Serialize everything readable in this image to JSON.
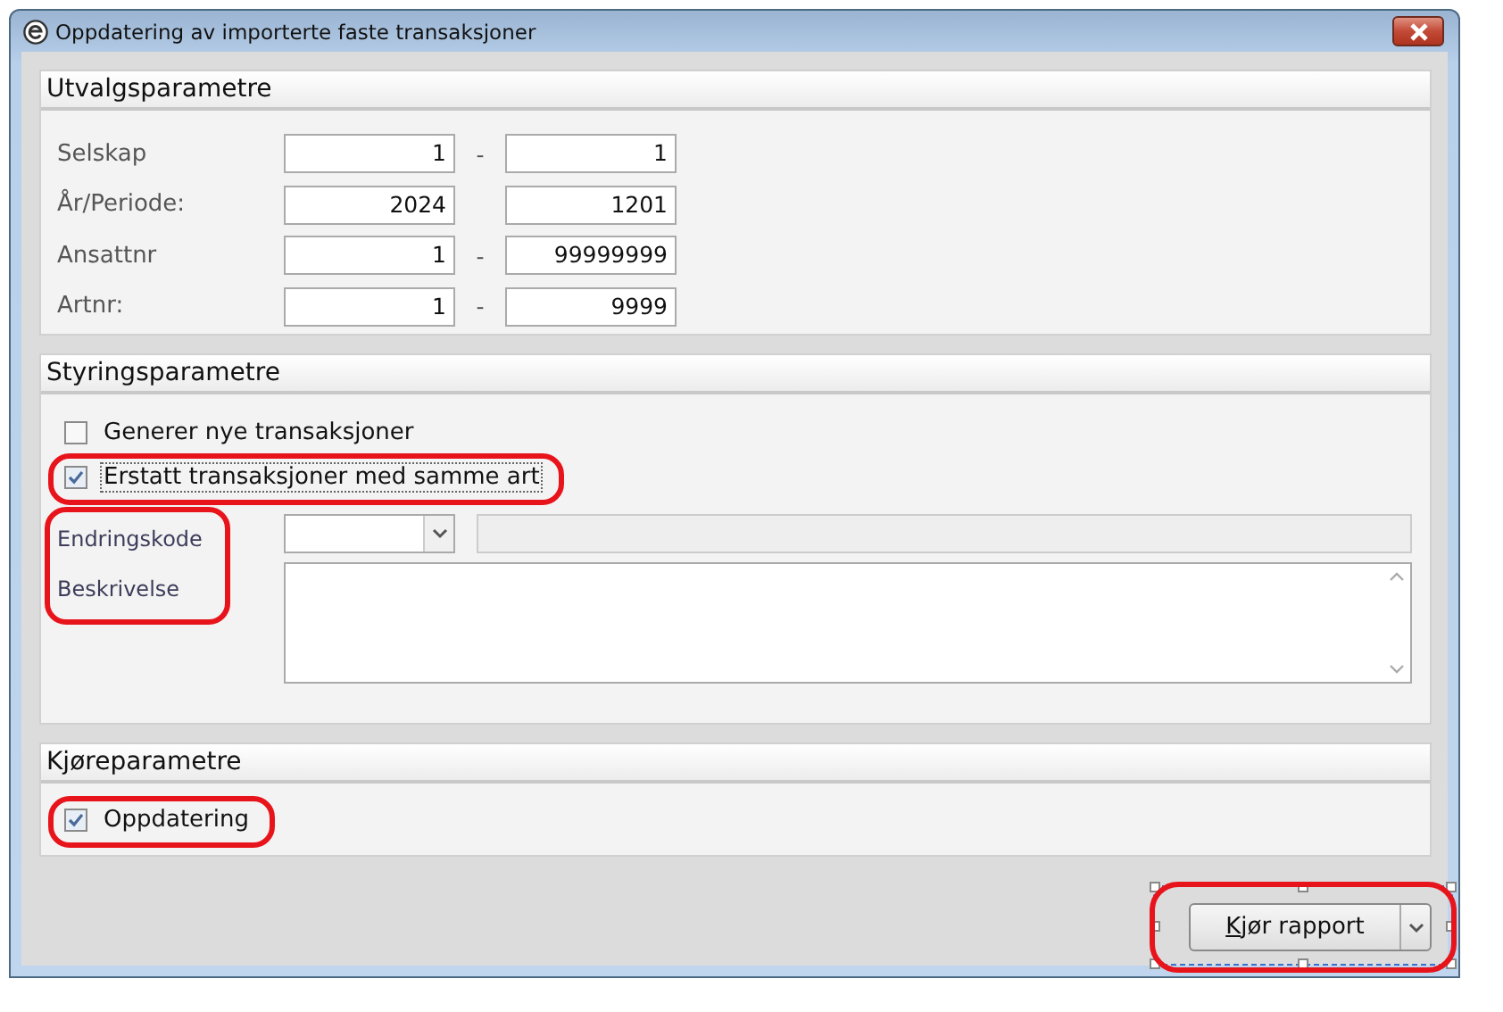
{
  "window": {
    "title": "Oppdatering av importerte faste transaksjoner"
  },
  "sections": [
    {
      "kind": "range",
      "title": "Utvalgsparametre",
      "rows": [
        {
          "label": "Selskap",
          "from": "1",
          "separator": "-",
          "to": "1"
        },
        {
          "label": "År/Periode:",
          "from": "2024",
          "to": "1201"
        },
        {
          "label": "Ansattnr",
          "from": "1",
          "separator": "-",
          "to": "99999999"
        },
        {
          "label": "Artnr:",
          "from": "1",
          "separator": "-",
          "to": "9999"
        }
      ]
    },
    {
      "kind": "control",
      "title": "Styringsparametre",
      "checkboxes": [
        {
          "label": "Generer nye transaksjoner",
          "checked": false,
          "focused": false,
          "highlighted": false
        },
        {
          "label": "Erstatt transaksjoner med samme art",
          "checked": true,
          "focused": true,
          "highlighted": true
        }
      ],
      "fields_highlighted": true,
      "fields": [
        {
          "kind": "dropdown",
          "label": "Endringskode"
        },
        {
          "kind": "textarea",
          "label": "Beskrivelse"
        }
      ]
    },
    {
      "kind": "run",
      "title": "Kjøreparametre",
      "checkboxes": [
        {
          "label": "Oppdatering",
          "checked": true,
          "focused": false,
          "highlighted": true
        }
      ]
    }
  ],
  "run_button": {
    "label": "Kjør rapport",
    "mnemonic_underlined": true,
    "has_menu": true,
    "highlighted": true,
    "selected": true
  }
}
